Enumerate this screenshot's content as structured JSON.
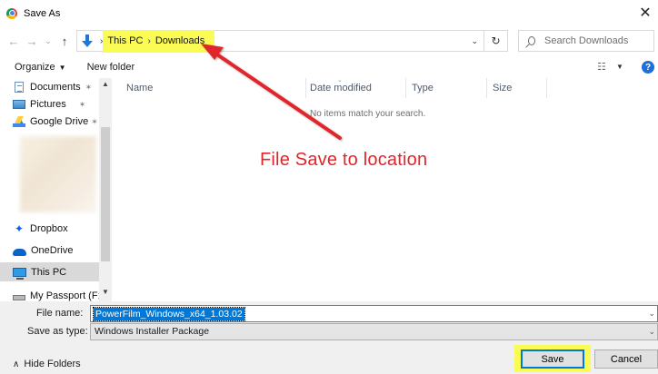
{
  "window": {
    "title": "Save As",
    "close_glyph": "✕",
    "app_icon": "chrome-icon"
  },
  "navigation": {
    "back_glyph": "←",
    "forward_glyph": "→",
    "recent_glyph": "⌄",
    "up_glyph": "↑"
  },
  "address": {
    "crumbs": [
      "This PC",
      "Downloads"
    ],
    "separator": "›",
    "dropdown_glyph": "⌄",
    "refresh_glyph": "↻",
    "highlight_color": "#fbfb55"
  },
  "search": {
    "placeholder": "Search Downloads"
  },
  "toolbar": {
    "organize_label": "Organize",
    "organize_caret": "▼",
    "new_folder_label": "New folder",
    "view_glyph": "☷",
    "view_caret": "▼",
    "help_label": "?"
  },
  "sidebar": {
    "items": [
      {
        "label": "Documents",
        "icon": "documents-icon",
        "pin": "📌"
      },
      {
        "label": "Pictures",
        "icon": "pictures-icon",
        "pin": "📌"
      },
      {
        "label": "Google Drive",
        "icon": "google-drive-icon",
        "pin": "📌"
      },
      {
        "label": "Dropbox",
        "icon": "dropbox-icon"
      },
      {
        "label": "OneDrive",
        "icon": "onedrive-icon"
      },
      {
        "label": "This PC",
        "icon": "this-pc-icon",
        "selected": true
      },
      {
        "label": "My Passport (F:)",
        "icon": "drive-icon"
      }
    ],
    "scroll_up_glyph": "▲",
    "scroll_down_glyph": "▼"
  },
  "file_list": {
    "columns": [
      "Name",
      "Date modified",
      "Type",
      "Size"
    ],
    "sort_glyph": "⌄",
    "empty_message": "No items match your search."
  },
  "annotation": {
    "text": "File Save to location",
    "color": "#e0252b"
  },
  "form": {
    "file_name_label": "File name:",
    "file_name_value": "PowerFilm_Windows_x64_1.03.02",
    "save_type_label": "Save as type:",
    "save_type_value": "Windows Installer Package",
    "dropdown_glyph": "⌄"
  },
  "footer": {
    "hide_folders_label": "Hide Folders",
    "hide_folders_glyph": "∧",
    "save_label": "Save",
    "cancel_label": "Cancel"
  }
}
